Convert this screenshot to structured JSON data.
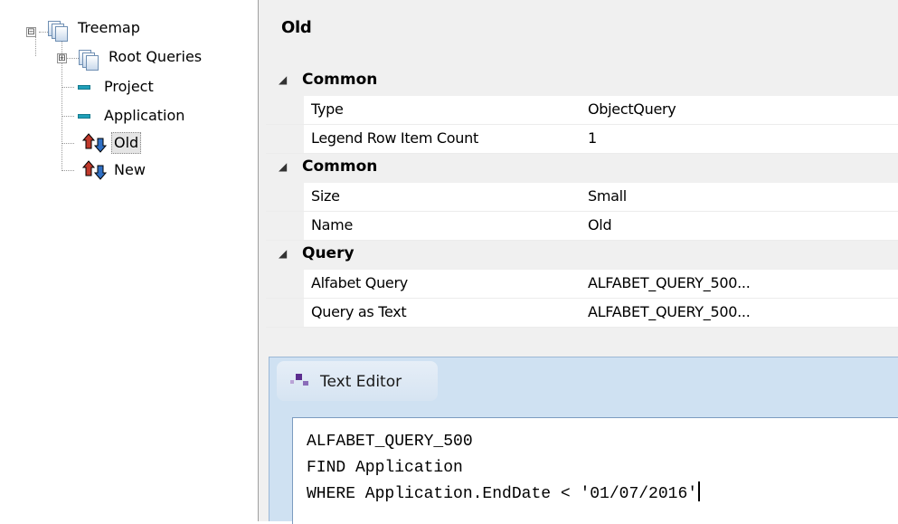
{
  "tree": {
    "root": {
      "label": "Treemap",
      "expander": "⊟"
    },
    "items": [
      {
        "label": "Root Queries",
        "icon": "pages-icon",
        "expander": "⊞"
      },
      {
        "label": "Project",
        "icon": "bar-icon"
      },
      {
        "label": "Application",
        "icon": "bar-icon"
      },
      {
        "label": "Old",
        "icon": "up-down-arrows-icon",
        "selected": true
      },
      {
        "label": "New",
        "icon": "up-down-arrows-icon"
      }
    ]
  },
  "property_panel": {
    "title": "Old",
    "groups": [
      {
        "name": "Common",
        "rows": [
          {
            "name": "Type",
            "value": "ObjectQuery"
          },
          {
            "name": "Legend Row Item Count",
            "value": "1"
          }
        ]
      },
      {
        "name": "Common",
        "rows": [
          {
            "name": "Size",
            "value": "Small"
          },
          {
            "name": "Name",
            "value": "Old"
          }
        ]
      },
      {
        "name": "Query",
        "rows": [
          {
            "name": "Alfabet Query",
            "value": "ALFABET_QUERY_500..."
          },
          {
            "name": "Query as Text",
            "value": "ALFABET_QUERY_500..."
          }
        ]
      }
    ]
  },
  "text_editor": {
    "title": "Text Editor",
    "lines": [
      "ALFABET_QUERY_500",
      "FIND Application",
      "WHERE Application.EndDate < '01/07/2016'"
    ]
  },
  "colors": {
    "tree_bar": "#1f9fb8",
    "arrow_up": "#c0392b",
    "arrow_down": "#2f6fc4",
    "editor_chrome": "#cfe1f2"
  }
}
